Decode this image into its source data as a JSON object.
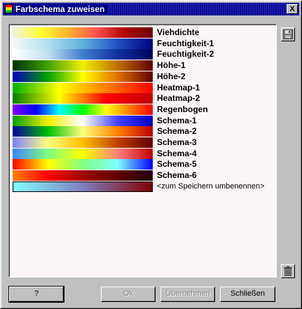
{
  "window": {
    "title": "Farbschema zuweisen",
    "close_label": "X"
  },
  "schemes": [
    {
      "label": "Viehdichte",
      "colors": [
        "#f0f0e0",
        "#ffff30",
        "#ffb030",
        "#ff5050",
        "#b00000",
        "#700000"
      ]
    },
    {
      "label": "Feuchtigkeit-1",
      "colors": [
        "#f8f8f8",
        "#b0e0f0",
        "#60b0e0",
        "#2050c0",
        "#000080"
      ]
    },
    {
      "label": "Feuchtigkeit-2",
      "colors": [
        "#ffffff",
        "#c0e0f0",
        "#4080d0",
        "#1030a0",
        "#000060"
      ]
    },
    {
      "label": "Höhe-1",
      "colors": [
        "#003000",
        "#40a000",
        "#f0f000",
        "#c07000",
        "#600000"
      ]
    },
    {
      "label": "Höhe-2",
      "colors": [
        "#0000c0",
        "#00a000",
        "#ffff00",
        "#e07000",
        "#600000"
      ]
    },
    {
      "label": "Heatmap-1",
      "colors": [
        "#00b000",
        "#ffff00",
        "#ff8000",
        "#ff0000"
      ]
    },
    {
      "label": "Heatmap-2",
      "colors": [
        "#008000",
        "#ffff00",
        "#ff0000",
        "#c00000"
      ]
    },
    {
      "label": "Regenbogen",
      "colors": [
        "#8000ff",
        "#0000ff",
        "#00ffff",
        "#00ff00",
        "#ffff00",
        "#ff8000",
        "#ff0000"
      ]
    },
    {
      "label": "Schema-1",
      "colors": [
        "#00a000",
        "#f0f000",
        "#ffffff",
        "#4040ff",
        "#0000c0"
      ]
    },
    {
      "label": "Schema-2",
      "colors": [
        "#0000a0",
        "#00c000",
        "#ffff80",
        "#ff8000",
        "#c00000"
      ]
    },
    {
      "label": "Schema-3",
      "colors": [
        "#8080ff",
        "#ffff80",
        "#ffc000",
        "#c04000",
        "#600000"
      ]
    },
    {
      "label": "Schema-4",
      "colors": [
        "#4080ff",
        "#80ff80",
        "#ffff00",
        "#ff8080",
        "#c00000"
      ]
    },
    {
      "label": "Schema-5",
      "colors": [
        "#ff0000",
        "#ffff00",
        "#80ff80",
        "#80ffff",
        "#0000ff"
      ]
    },
    {
      "label": "Schema-6",
      "colors": [
        "#ff8000",
        "#ff0000",
        "#a00000",
        "#600000",
        "#200000"
      ]
    },
    {
      "label": "<zum Speichern umbenennen>",
      "colors": [
        "#80ffff",
        "#8080c0",
        "#800000"
      ]
    }
  ],
  "buttons": {
    "help": "?",
    "ok": "Ok",
    "apply": "Übernehmen",
    "close": "Schließen"
  }
}
